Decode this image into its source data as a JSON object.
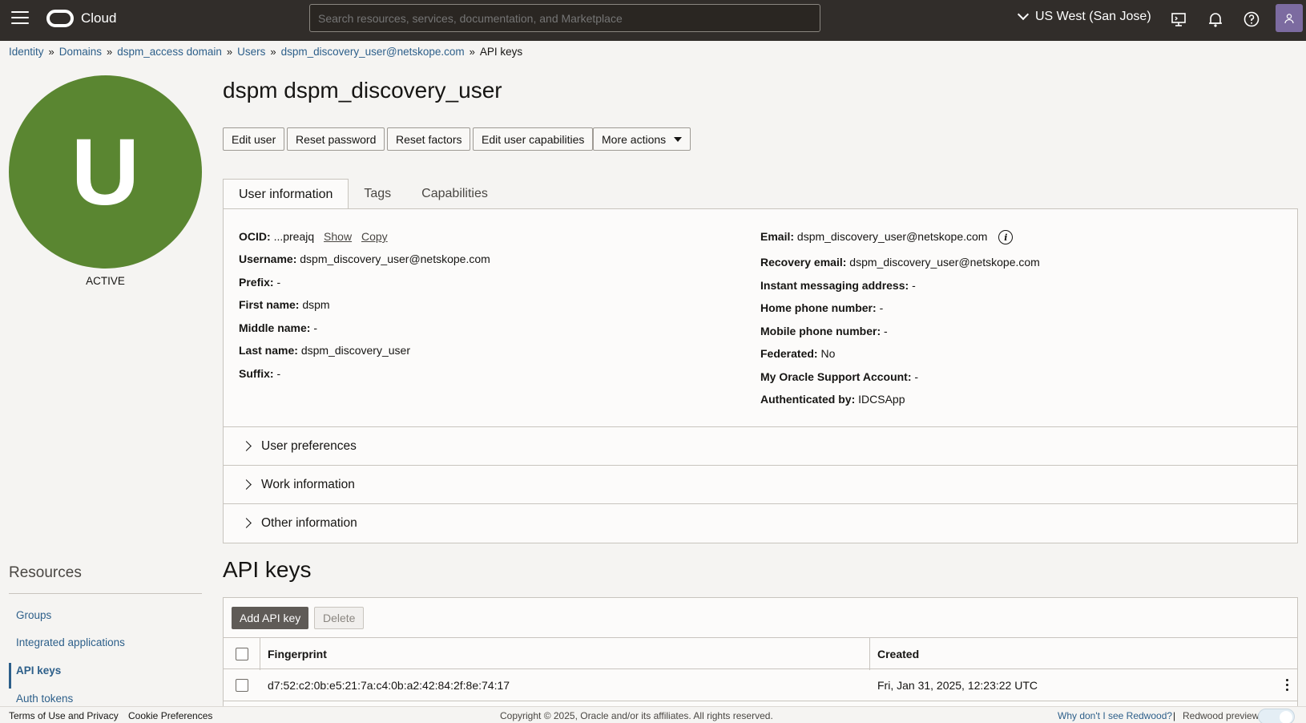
{
  "header": {
    "brand": "Cloud",
    "search_placeholder": "Search resources, services, documentation, and Marketplace",
    "region": "US West (San Jose)"
  },
  "breadcrumb": [
    "Identity",
    "Domains",
    "dspm_access domain",
    "Users",
    "dspm_discovery_user@netskope.com",
    "API keys"
  ],
  "profile": {
    "initial": "U",
    "status": "ACTIVE"
  },
  "page": {
    "title": "dspm dspm_discovery_user",
    "actions": {
      "edit": "Edit user",
      "reset_password": "Reset password",
      "reset_factors": "Reset factors",
      "edit_capabilities": "Edit user capabilities",
      "more": "More actions"
    },
    "tabs": [
      "User information",
      "Tags",
      "Capabilities"
    ]
  },
  "user_info": {
    "ocid_label": "OCID:",
    "ocid_value": "...preajq",
    "show": "Show",
    "copy": "Copy",
    "left": [
      {
        "label": "Username:",
        "value": "dspm_discovery_user@netskope.com"
      },
      {
        "label": "Prefix:",
        "value": "-"
      },
      {
        "label": "First name:",
        "value": "dspm"
      },
      {
        "label": "Middle name:",
        "value": "-"
      },
      {
        "label": "Last name:",
        "value": "dspm_discovery_user"
      },
      {
        "label": "Suffix:",
        "value": "-"
      }
    ],
    "email_label": "Email:",
    "email_value": "dspm_discovery_user@netskope.com",
    "right": [
      {
        "label": "Recovery email:",
        "value": "dspm_discovery_user@netskope.com"
      },
      {
        "label": "Instant messaging address:",
        "value": "-"
      },
      {
        "label": "Home phone number:",
        "value": "-"
      },
      {
        "label": "Mobile phone number:",
        "value": "-"
      },
      {
        "label": "Federated:",
        "value": "No"
      },
      {
        "label": "My Oracle Support Account:",
        "value": "-"
      },
      {
        "label": "Authenticated by:",
        "value": "IDCSApp"
      }
    ]
  },
  "sections": [
    "User preferences",
    "Work information",
    "Other information"
  ],
  "resources": {
    "title": "Resources",
    "items": [
      "Groups",
      "Integrated applications",
      "API keys",
      "Auth tokens"
    ]
  },
  "api_keys": {
    "title": "API keys",
    "add": "Add API key",
    "delete": "Delete",
    "columns": [
      "Fingerprint",
      "Created"
    ],
    "rows": [
      {
        "fingerprint": "d7:52:c2:0b:e5:21:7a:c4:0b:a2:42:84:2f:8e:74:17",
        "created": "Fri, Jan 31, 2025, 12:23:22 UTC"
      }
    ]
  },
  "footer": {
    "terms": "Terms of Use and Privacy",
    "cookies": "Cookie Preferences",
    "copyright": "Copyright © 2025, Oracle and/or its affiliates. All rights reserved.",
    "why": "Why don't I see Redwood?",
    "divider": "|",
    "preview": "Redwood preview"
  }
}
